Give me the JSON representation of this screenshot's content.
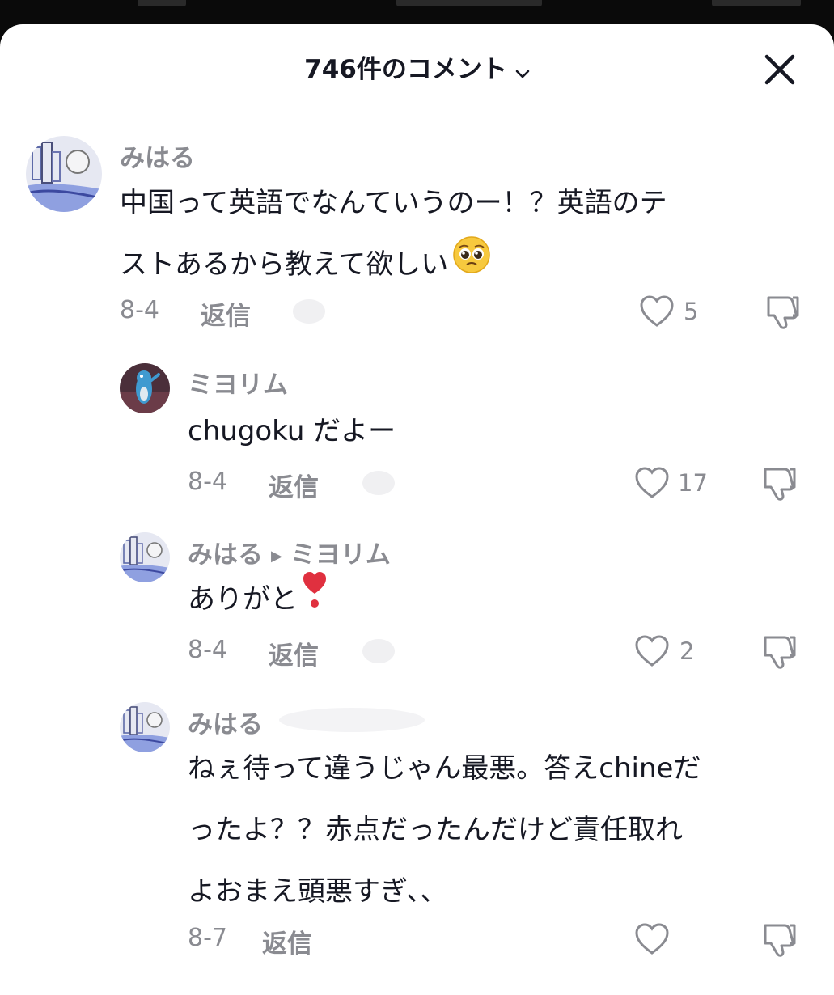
{
  "header": {
    "title": "746件のコメント"
  },
  "comments": [
    {
      "name": "みはる",
      "lines": [
        "中国って英語でなんていうのー！？英語のテ",
        "ストあるから教えて欲しい"
      ],
      "date": "8-4",
      "reply": "返信",
      "likes": "5",
      "emoji": "pleading-face"
    },
    {
      "name": "ミヨリム",
      "lines": [
        "chugoku だよー"
      ],
      "date": "8-4",
      "reply": "返信",
      "likes": "17"
    },
    {
      "name": "みはる",
      "reply_to": "ミヨリム",
      "lines": [
        "ありがと"
      ],
      "date": "8-4",
      "reply": "返信",
      "likes": "2",
      "emoji": "heart-exclamation"
    },
    {
      "name": "みはる",
      "lines": [
        "ねぇ待って違うじゃん最悪。答えchineだ",
        "ったよ？？赤点だったんだけど責任取れ",
        "よおまえ頭悪すぎ、、"
      ],
      "date": "8-7",
      "reply": "返信",
      "likes": ""
    }
  ],
  "colors": {
    "text": "#161823",
    "muted": "#8a8b91",
    "accent_heart": "#e0303f"
  }
}
